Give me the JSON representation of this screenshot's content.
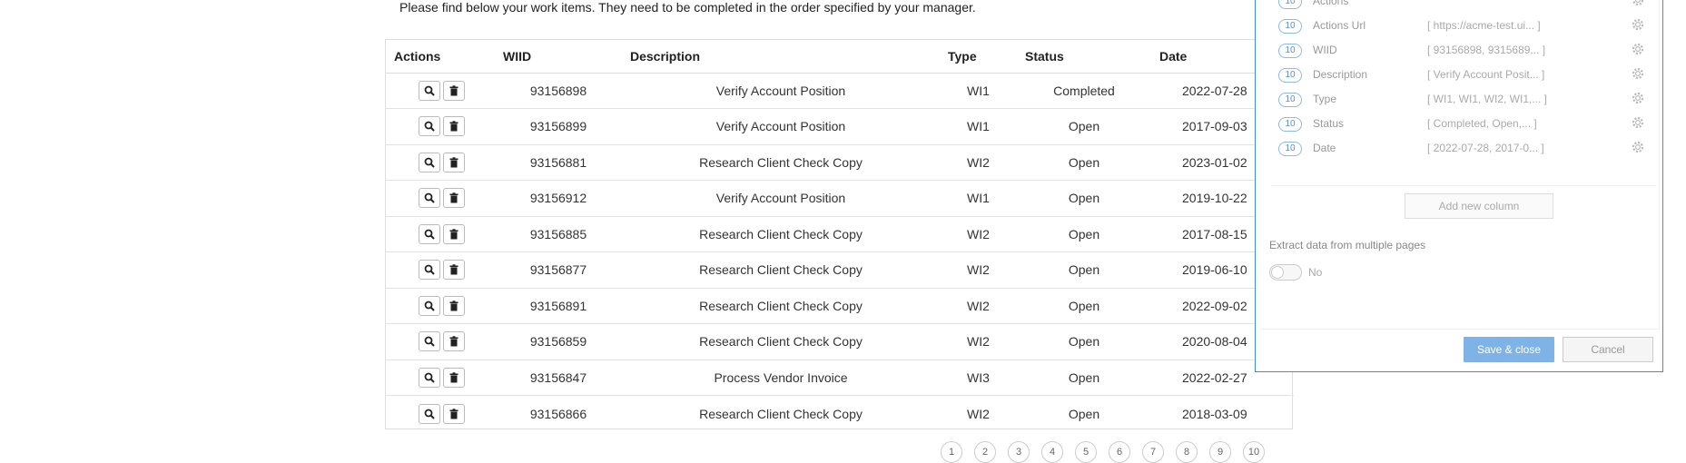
{
  "intro_text": "Please find below your work items. They need to be completed in the order specified by your manager.",
  "table": {
    "headers": [
      "Actions",
      "WIID",
      "Description",
      "Type",
      "Status",
      "Date"
    ],
    "rows": [
      {
        "wiid": "93156898",
        "description": "Verify Account Position",
        "type": "WI1",
        "status": "Completed",
        "date": "2022-07-28"
      },
      {
        "wiid": "93156899",
        "description": "Verify Account Position",
        "type": "WI1",
        "status": "Open",
        "date": "2017-09-03"
      },
      {
        "wiid": "93156881",
        "description": "Research Client Check Copy",
        "type": "WI2",
        "status": "Open",
        "date": "2023-01-02"
      },
      {
        "wiid": "93156912",
        "description": "Verify Account Position",
        "type": "WI1",
        "status": "Open",
        "date": "2019-10-22"
      },
      {
        "wiid": "93156885",
        "description": "Research Client Check Copy",
        "type": "WI2",
        "status": "Open",
        "date": "2017-08-15"
      },
      {
        "wiid": "93156877",
        "description": "Research Client Check Copy",
        "type": "WI2",
        "status": "Open",
        "date": "2019-06-10"
      },
      {
        "wiid": "93156891",
        "description": "Research Client Check Copy",
        "type": "WI2",
        "status": "Open",
        "date": "2022-09-02"
      },
      {
        "wiid": "93156859",
        "description": "Research Client Check Copy",
        "type": "WI2",
        "status": "Open",
        "date": "2020-08-04"
      },
      {
        "wiid": "93156847",
        "description": "Process Vendor Invoice",
        "type": "WI3",
        "status": "Open",
        "date": "2022-02-27"
      },
      {
        "wiid": "93156866",
        "description": "Research Client Check Copy",
        "type": "WI2",
        "status": "Open",
        "date": "2018-03-09"
      }
    ]
  },
  "pager": {
    "pages": [
      "1",
      "2",
      "3",
      "4",
      "5",
      "6",
      "7",
      "8",
      "9",
      "10"
    ]
  },
  "panel": {
    "columns": [
      {
        "count": "10",
        "name": "Actions",
        "value": ""
      },
      {
        "count": "10",
        "name": "Actions Url",
        "value": "[ https://acme-test.ui... ]"
      },
      {
        "count": "10",
        "name": "WIID",
        "value": "[ 93156898, 9315689... ]"
      },
      {
        "count": "10",
        "name": "Description",
        "value": "[ Verify Account Posit... ]"
      },
      {
        "count": "10",
        "name": "Type",
        "value": "[ WI1, WI1, WI2, WI1,... ]"
      },
      {
        "count": "10",
        "name": "Status",
        "value": "[ Completed, Open,... ]"
      },
      {
        "count": "10",
        "name": "Date",
        "value": "[ 2022-07-28, 2017-0... ]"
      }
    ],
    "add_column_label": "Add new column",
    "multi_page_label": "Extract data from multiple pages",
    "multi_page_value": "No",
    "save_label": "Save & close",
    "cancel_label": "Cancel"
  },
  "icons": {
    "view": "search-icon",
    "delete": "trash-icon",
    "settings": "gear-icon"
  },
  "colors": {
    "accent": "#7fb3e6",
    "panel_border": "#3d8ee0",
    "badge": "#5a8fd0"
  }
}
